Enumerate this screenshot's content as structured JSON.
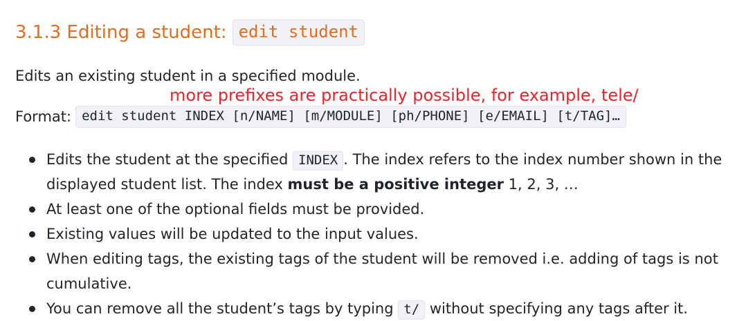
{
  "heading": {
    "text": "3.1.3 Editing a student:",
    "code": "edit student"
  },
  "intro": "Edits an existing student in a specified module.",
  "annotation": "more prefixes are practically possible, for example, tele/",
  "format": {
    "label": "Format:",
    "code": "edit student INDEX [n/NAME] [m/MODULE] [ph/PHONE] [e/EMAIL] [t/TAG]…"
  },
  "bullets": {
    "b1": {
      "pre": "Edits the student at the specified",
      "code": "INDEX",
      "post": ". The index refers to the index number shown in the",
      "line2_pre": "displayed student list. The index",
      "bold": "must be a positive integer",
      "line2_post": "1, 2, 3, …"
    },
    "b2": "At least one of the optional fields must be provided.",
    "b3": "Existing values will be updated to the input values.",
    "b4": {
      "line1": "When editing tags, the existing tags of the student will be removed i.e. adding of tags is not",
      "line2": "cumulative."
    },
    "b5": {
      "pre": "You can remove all the student’s tags by typing",
      "code": "t/",
      "post": "without specifying any tags after it."
    }
  },
  "colors": {
    "heading": "#e46c1e",
    "annotation": "#e8242c",
    "text": "#212529",
    "code_bg": "#f1f1f8"
  }
}
